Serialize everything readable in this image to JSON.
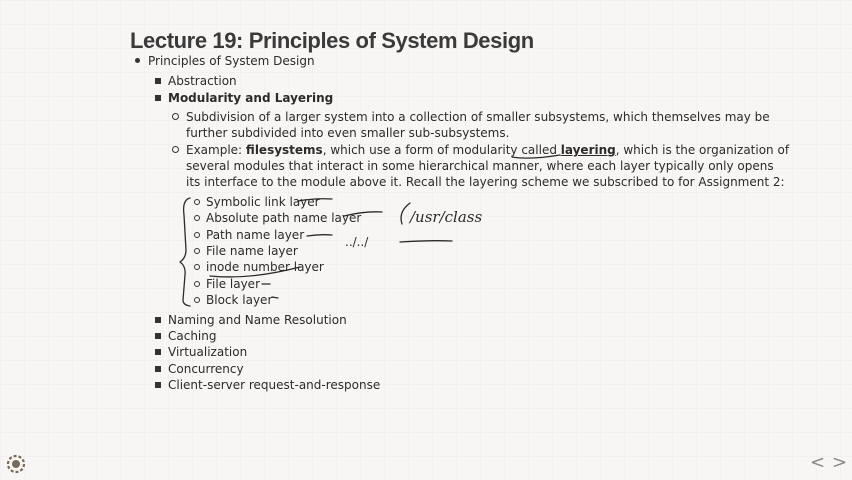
{
  "title": "Lecture 19: Principles of System Design",
  "level1": "Principles of System Design",
  "items": {
    "abstraction": "Abstraction",
    "modularity": "Modularity and Layering",
    "naming": "Naming and Name Resolution",
    "caching": "Caching",
    "virtualization": "Virtualization",
    "concurrency": "Concurrency",
    "client_server": "Client-server request-and-response"
  },
  "modularity": {
    "sub1_line1": "Subdivision of a larger system into a collection of smaller subsystems, which themselves may be",
    "sub1_line2": "further subdivided into even smaller sub-subsystems.",
    "ex_prefix": "Example: ",
    "ex_bold": "filesystems",
    "ex_mid": ", which use a form of modularity called ",
    "ex_under": "layering",
    "ex_suffix": ", which is the organization of",
    "ex_line2": "several modules that interact in some hierarchical manner, where each layer typically only opens",
    "ex_line3": "its interface to the module above it. Recall the layering scheme we subscribed to for Assignment 2:"
  },
  "layers": [
    "Symbolic link layer",
    "Absolute path name layer",
    "Path name layer",
    "File name layer",
    "inode number layer",
    "File layer",
    "Block layer"
  ],
  "annotations": {
    "path": "/usr/class",
    "dots": "../../"
  },
  "nav": {
    "prev": "<",
    "next": ">"
  }
}
